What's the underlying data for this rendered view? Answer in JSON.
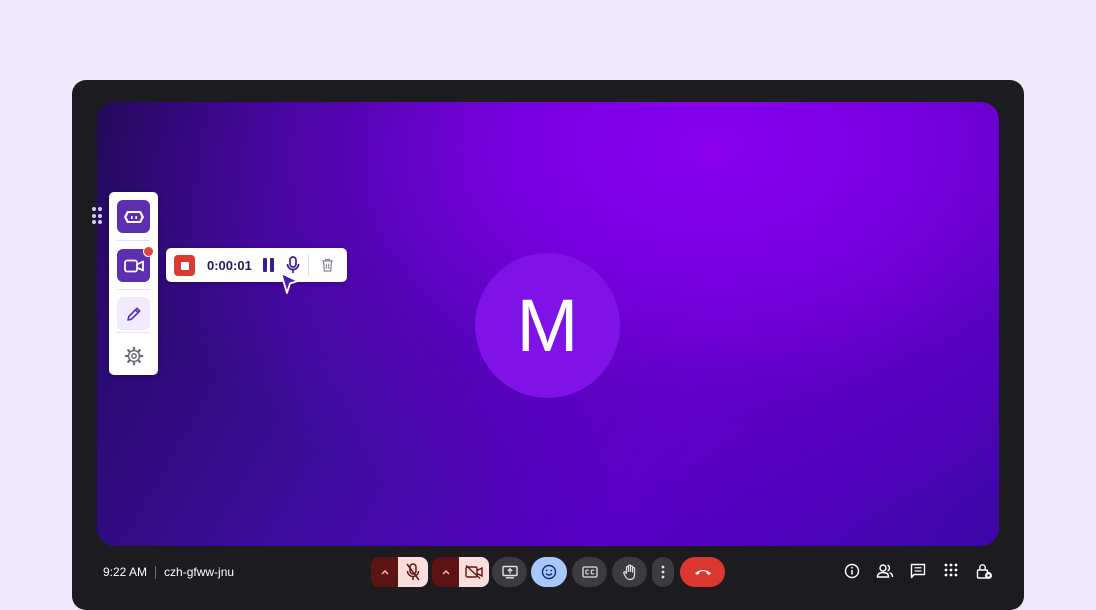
{
  "avatar": {
    "initial": "M"
  },
  "recorder": {
    "elapsed": "0:00:01"
  },
  "meeting": {
    "time": "9:22 AM",
    "code": "czh-gfww-jnu"
  },
  "colors": {
    "background": "#efe8fb",
    "frame": "#1c1b1f",
    "stage_accent": "#7f12e6",
    "toolbar_purple": "#5b2fb0",
    "record_red": "#d93a33",
    "hangup_red": "#dc3630",
    "reaction_blue": "#a8c7fa"
  },
  "icons": {
    "side_panel": [
      "drag-handle-icon",
      "robot-logo-icon",
      "video-camera-icon",
      "pencil-icon",
      "gear-icon"
    ],
    "recorder": [
      "stop-icon",
      "pause-icon",
      "microphone-icon",
      "trash-icon"
    ],
    "controls": [
      "chevron-up-icon",
      "mic-off-icon",
      "chevron-up-icon",
      "video-off-icon",
      "present-screen-icon",
      "emoji-icon",
      "captions-icon",
      "raise-hand-icon",
      "more-vert-icon",
      "call-end-icon"
    ],
    "right": [
      "info-icon",
      "people-icon",
      "chat-icon",
      "apps-icon",
      "host-controls-icon"
    ]
  }
}
